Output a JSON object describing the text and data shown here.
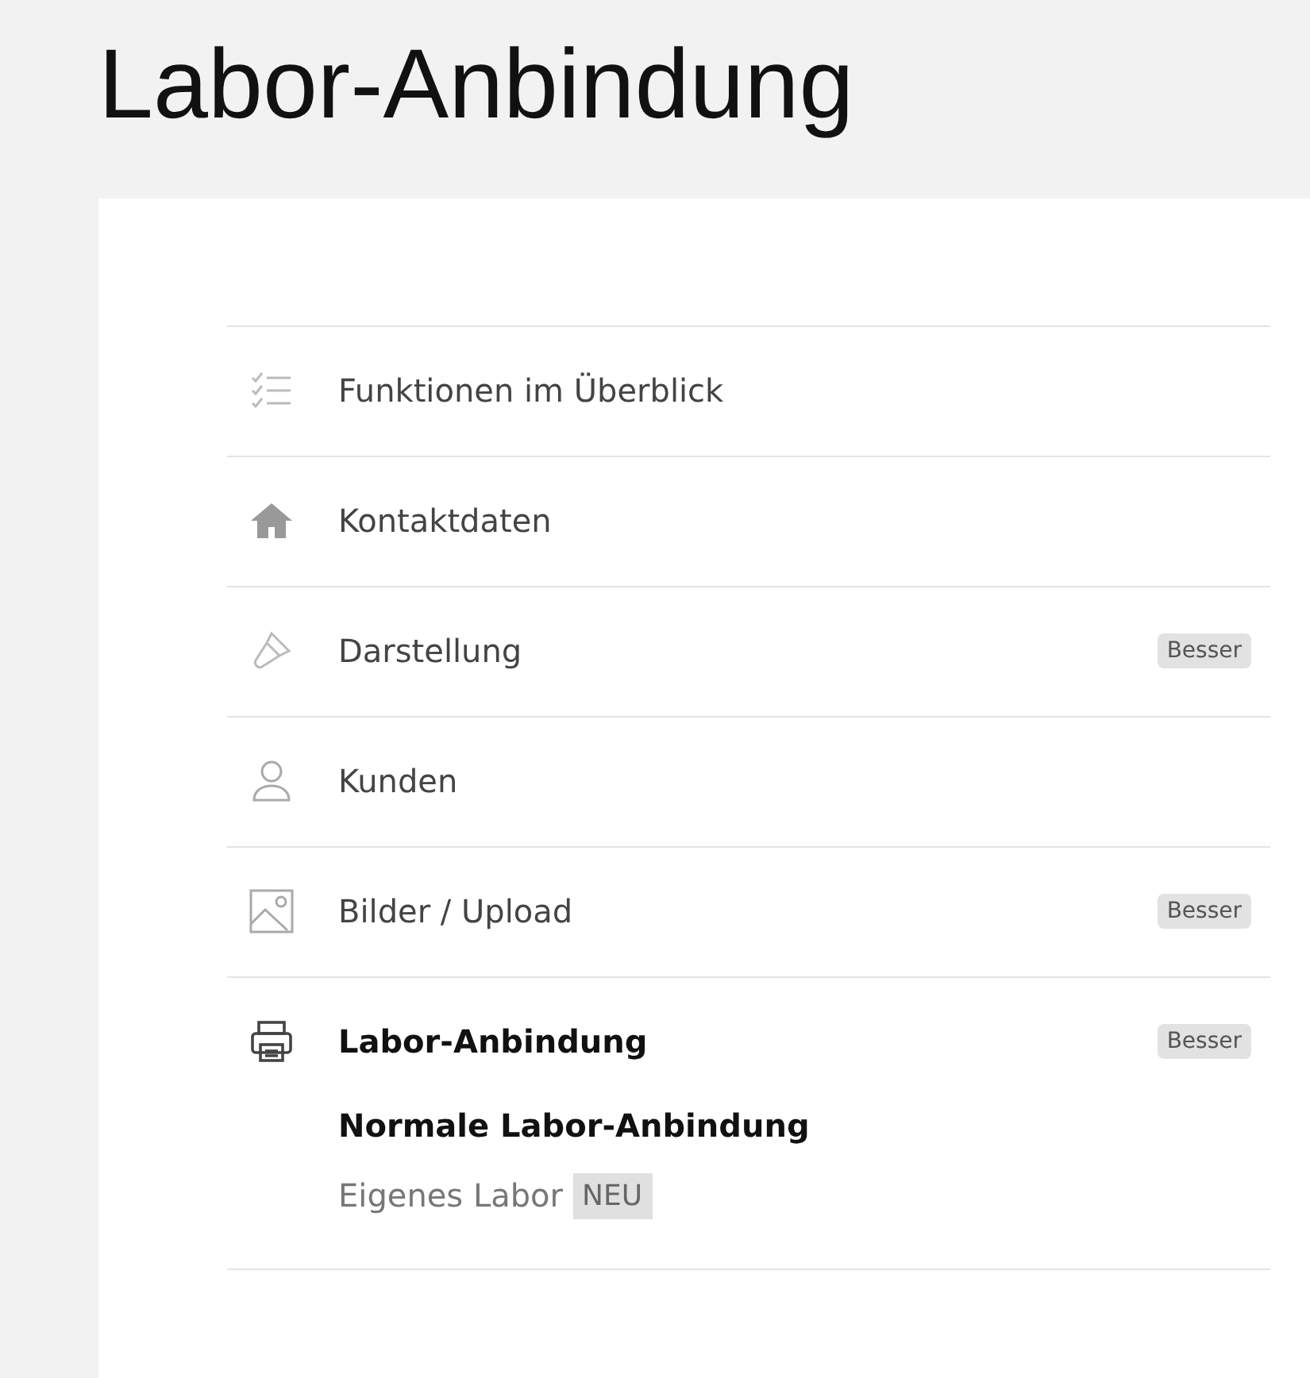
{
  "page_title": "Labor-Anbindung",
  "menu": [
    {
      "label": "Funktionen im Überblick",
      "selected": false
    },
    {
      "label": "Kontaktdaten",
      "selected": false
    },
    {
      "label": "Darstellung",
      "badge": "Besser",
      "selected": false
    },
    {
      "label": "Kunden",
      "selected": false
    },
    {
      "label": "Bilder / Upload",
      "badge": "Besser",
      "selected": false
    },
    {
      "label": "Labor-Anbindung",
      "badge": "Besser",
      "selected": true,
      "children": [
        {
          "label": "Normale Labor-Anbindung",
          "selected": true
        },
        {
          "label": "Eigenes Labor",
          "badge": "NEU",
          "selected": false
        }
      ]
    }
  ]
}
